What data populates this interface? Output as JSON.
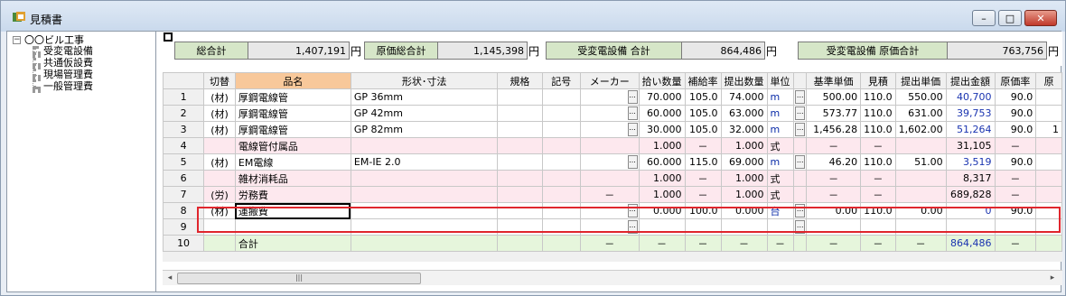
{
  "window": {
    "title": "見積書",
    "controls": {
      "minimize": "–",
      "maximize": "□",
      "close": "✕"
    }
  },
  "tree": {
    "root": "〇〇ビル工事",
    "children": [
      "受変電設備",
      "共通仮設費",
      "現場管理費",
      "一般管理費"
    ],
    "expander": "−"
  },
  "summary": [
    {
      "label": "総合計",
      "value": "1,407,191",
      "unit": "円"
    },
    {
      "label": "原価総合計",
      "value": "1,145,398",
      "unit": "円"
    },
    {
      "label": "受変電設備 合計",
      "value": "864,486",
      "unit": "円"
    },
    {
      "label": "受変電設備 原価合計",
      "value": "763,756",
      "unit": "円"
    }
  ],
  "grid": {
    "headers": [
      "",
      "切替",
      "品名",
      "形状･寸法",
      "規格",
      "記号",
      "メーカー",
      "拾い数量",
      "補給率",
      "提出数量",
      "単位",
      "",
      "基準単価",
      "見積",
      "提出単価",
      "提出金額",
      "原価率",
      "原"
    ],
    "button_label": "...",
    "rows": [
      {
        "no": "1",
        "kiri": "(材)",
        "name": "厚鋼電線管",
        "shape": "GP 36mm",
        "spec": "",
        "sym": "",
        "maker": "",
        "qty": "70.000",
        "rate": "105.0",
        "sub": "74.000",
        "unit": "m",
        "base": "500.00",
        "mitsu": "110.0",
        "price": "550.00",
        "amount": "40,700",
        "cost": "90.0",
        "hara": ""
      },
      {
        "no": "2",
        "kiri": "(材)",
        "name": "厚鋼電線管",
        "shape": "GP 42mm",
        "spec": "",
        "sym": "",
        "maker": "",
        "qty": "60.000",
        "rate": "105.0",
        "sub": "63.000",
        "unit": "m",
        "base": "573.77",
        "mitsu": "110.0",
        "price": "631.00",
        "amount": "39,753",
        "cost": "90.0",
        "hara": ""
      },
      {
        "no": "3",
        "kiri": "(材)",
        "name": "厚鋼電線管",
        "shape": "GP 82mm",
        "spec": "",
        "sym": "",
        "maker": "",
        "qty": "30.000",
        "rate": "105.0",
        "sub": "32.000",
        "unit": "m",
        "base": "1,456.28",
        "mitsu": "110.0",
        "price": "1,602.00",
        "amount": "51,264",
        "cost": "90.0",
        "hara": "1"
      },
      {
        "no": "4",
        "kiri": "",
        "name": "電線管付属品",
        "shape": "",
        "spec": "",
        "sym": "",
        "maker": "",
        "qty": "1.000",
        "rate": "－",
        "sub": "1.000",
        "unit": "式",
        "base": "－",
        "mitsu": "－",
        "price": "",
        "amount": "31,105",
        "cost": "－",
        "hara": ""
      },
      {
        "no": "5",
        "kiri": "(材)",
        "name": "EM電線",
        "shape": "EM-IE 2.0",
        "spec": "",
        "sym": "",
        "maker": "",
        "qty": "60.000",
        "rate": "115.0",
        "sub": "69.000",
        "unit": "m",
        "base": "46.20",
        "mitsu": "110.0",
        "price": "51.00",
        "amount": "3,519",
        "cost": "90.0",
        "hara": ""
      },
      {
        "no": "6",
        "kiri": "",
        "name": "雑材消耗品",
        "shape": "",
        "spec": "",
        "sym": "",
        "maker": "",
        "qty": "1.000",
        "rate": "－",
        "sub": "1.000",
        "unit": "式",
        "base": "－",
        "mitsu": "－",
        "price": "",
        "amount": "8,317",
        "cost": "－",
        "hara": ""
      },
      {
        "no": "7",
        "kiri": "(労)",
        "name": "労務費",
        "shape": "",
        "spec": "",
        "sym": "",
        "maker": "－",
        "qty": "1.000",
        "rate": "－",
        "sub": "1.000",
        "unit": "式",
        "base": "－",
        "mitsu": "－",
        "price": "",
        "amount": "689,828",
        "cost": "－",
        "hara": ""
      },
      {
        "no": "8",
        "kiri": "(材)",
        "name": "運搬費",
        "shape": "",
        "spec": "",
        "sym": "",
        "maker": "",
        "qty": "0.000",
        "rate": "100.0",
        "sub": "0.000",
        "unit": "台",
        "base": "0.00",
        "mitsu": "110.0",
        "price": "0.00",
        "amount": "0",
        "cost": "90.0",
        "hara": ""
      },
      {
        "no": "9",
        "kiri": "",
        "name": "",
        "shape": "",
        "spec": "",
        "sym": "",
        "maker": "",
        "qty": "",
        "rate": "",
        "sub": "",
        "unit": "",
        "base": "",
        "mitsu": "",
        "price": "",
        "amount": "",
        "cost": "",
        "hara": ""
      },
      {
        "no": "10",
        "kiri": "",
        "name": "合計",
        "shape": "",
        "spec": "",
        "sym": "",
        "maker": "－",
        "qty": "－",
        "rate": "－",
        "sub": "－",
        "unit": "－",
        "base": "－",
        "mitsu": "－",
        "price": "－",
        "amount": "864,486",
        "cost": "－",
        "hara": ""
      }
    ]
  },
  "scrollbar": {
    "left": "◂",
    "right": "▸",
    "thumb": "|||"
  }
}
